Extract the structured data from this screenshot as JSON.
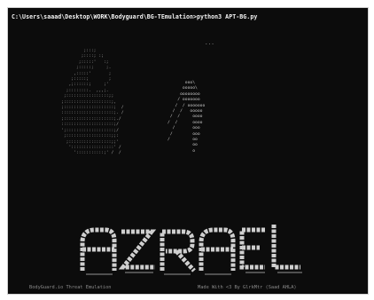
{
  "console": {
    "prompt": "C:\\Users\\saaad\\Desktop\\WORK\\Bodyguard\\BG-TEmulation>python3 APT-BG.py",
    "dots": "...",
    "banner_text": "AZRAEL",
    "footer_left": "BodyGuard.io Threat Emulation",
    "footer_right": "Made With <3 By GlrkMtr (Saad AHLA)"
  },
  "colors": {
    "background": "#0c0c0c",
    "prompt_text": "#f2f2f2",
    "art": "#a6a6a6",
    "banner": "#cfcfcf"
  }
}
